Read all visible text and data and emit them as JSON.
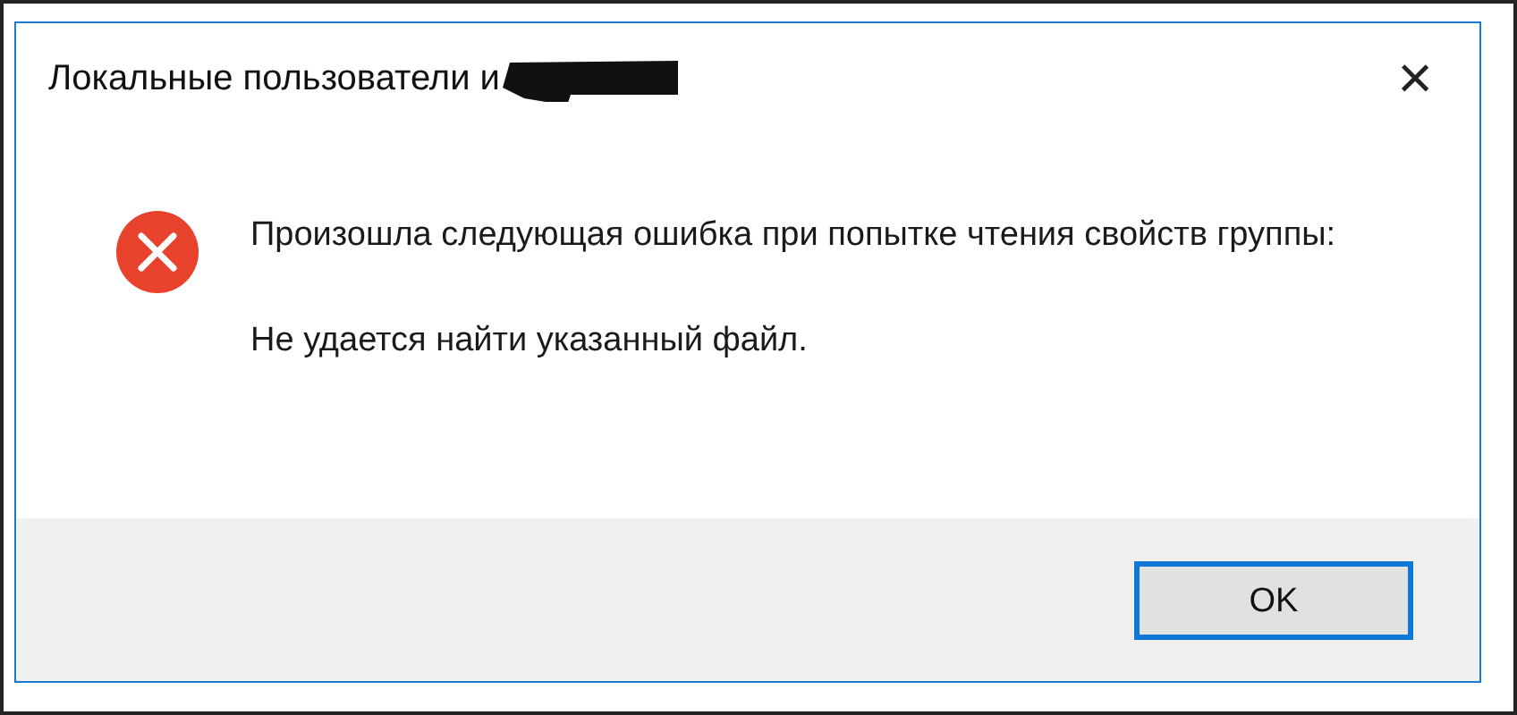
{
  "window": {
    "title": "Локальные пользователи и",
    "close": "×"
  },
  "message": {
    "kind": "error",
    "lines": [
      "Произошла следующая ошибка при попытке чтения свойств группы:",
      "Не удается найти указанный файл."
    ]
  },
  "buttons": [
    {
      "label": "OK",
      "default": true
    }
  ]
}
